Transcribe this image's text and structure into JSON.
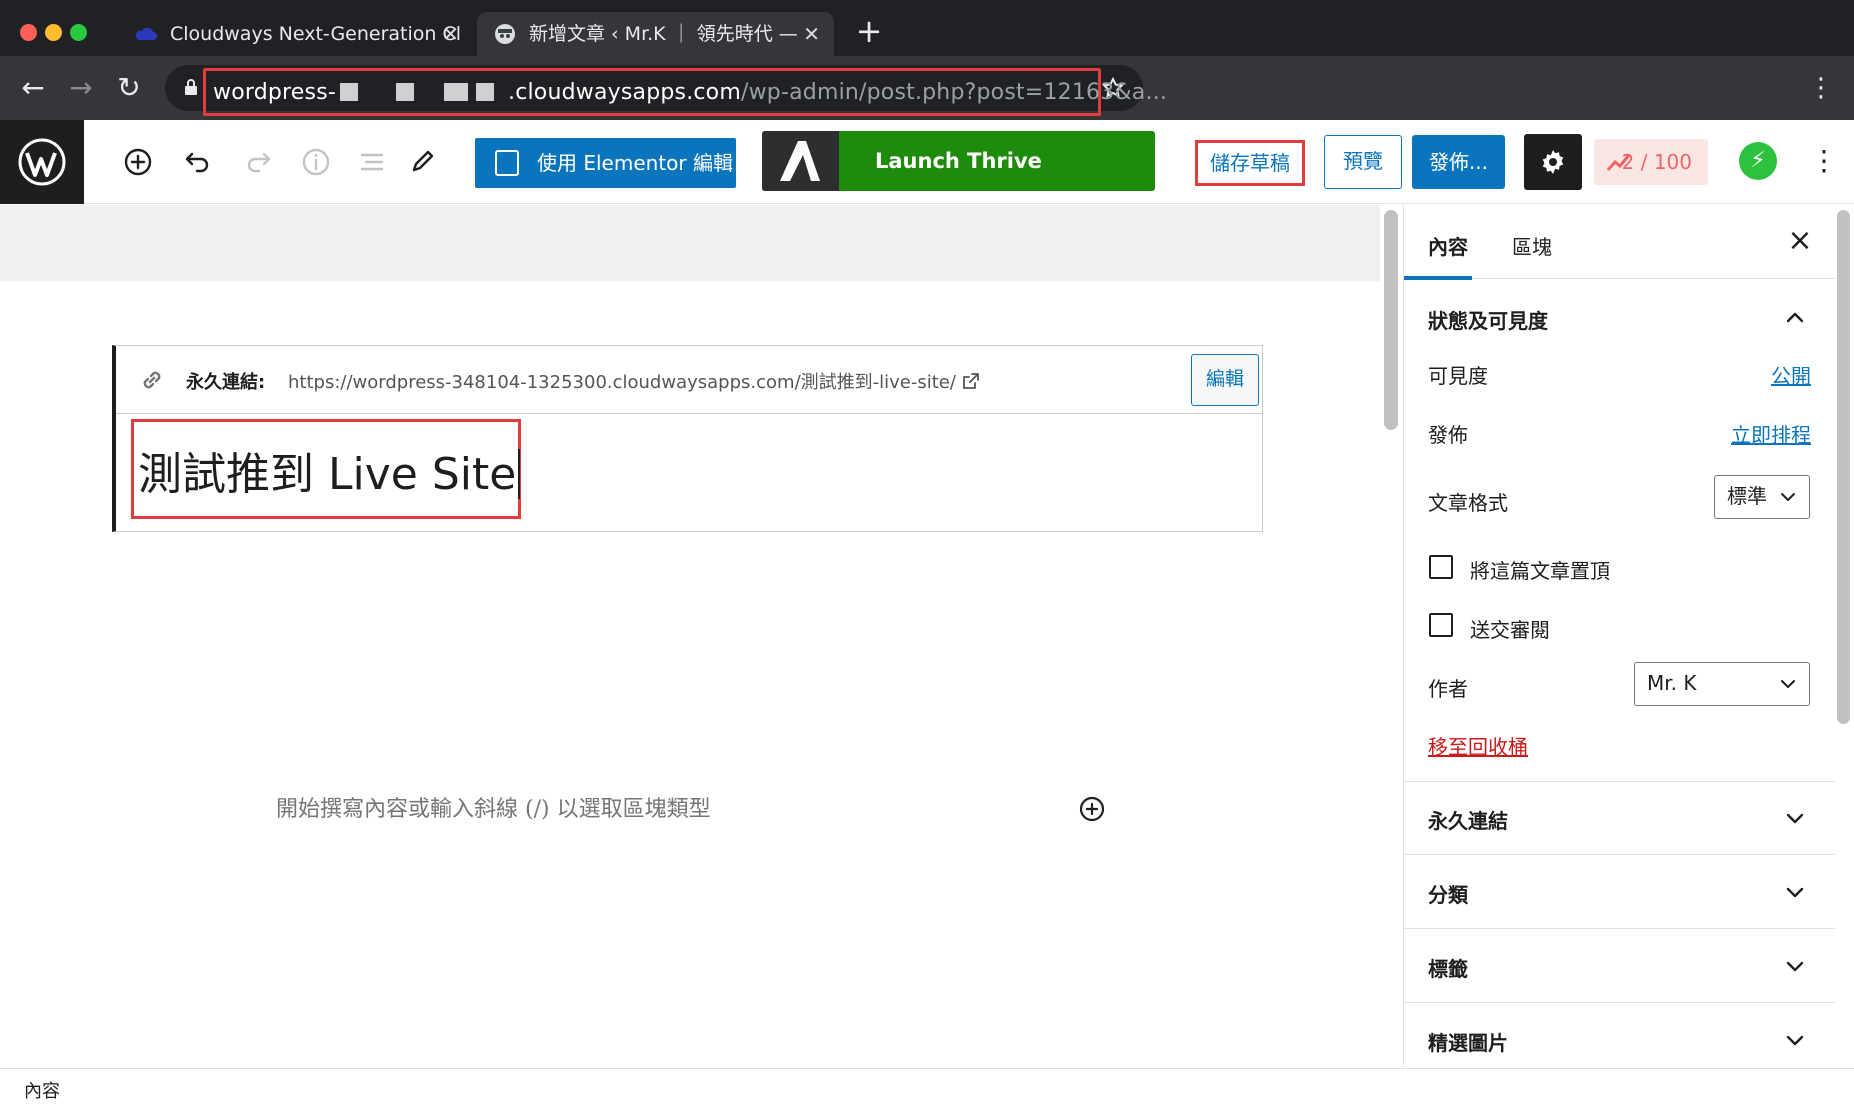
{
  "browser": {
    "tabs": [
      {
        "title": "Cloudways Next-Generation Cl",
        "active": false
      },
      {
        "title": "新增文章 ‹ Mr.K ｜ 領先時代 — ",
        "active": true
      }
    ],
    "address": {
      "host_start": "wordpress-",
      "host_end": ".cloudwaysapps.com",
      "path": "/wp-admin/post.php?post=12163&a..."
    },
    "extensions": [
      "stop-sign-icon",
      "translate-icon",
      "s-extension-icon",
      "v-extension-icon",
      "notion-icon",
      "pdf-icon",
      "github-icon",
      "wallet-icon",
      "m-extension-icon",
      "k-extension-icon",
      "d-extension-icon",
      "vivaldi-icon"
    ]
  },
  "toolbar": {
    "elementor_label": "使用 Elementor 編輯",
    "thrive_label": "Launch Thrive Architect",
    "save_draft_label": "儲存草稿",
    "preview_label": "預覽",
    "publish_label": "發佈...",
    "counter": "2 / 100"
  },
  "editor": {
    "permalink_label": "永久連結:",
    "permalink_url": "https://wordpress-348104-1325300.cloudwaysapps.com/測試推到-live-site/",
    "permalink_edit": "編輯",
    "title": "測試推到 Live Site",
    "placeholder": "開始撰寫內容或輸入斜線 (/) 以選取區塊類型"
  },
  "sidebar": {
    "tabs": [
      "內容",
      "區塊"
    ],
    "status_panel_title": "狀態及可見度",
    "visibility_label": "可見度",
    "visibility_value": "公開",
    "publish_label": "發佈",
    "publish_value": "立即排程",
    "format_label": "文章格式",
    "format_value": "標準",
    "sticky_label": "將這篇文章置頂",
    "review_label": "送交審閱",
    "author_label": "作者",
    "author_value": "Mr. K",
    "trash_label": "移至回收桶",
    "panels": [
      "永久連結",
      "分類",
      "標籤",
      "精選圖片"
    ]
  },
  "footer": {
    "breadcrumb": "內容"
  },
  "colors": {
    "accent": "#0a75bc",
    "highlight": "#e23c3c",
    "thrive_green": "#1f8b0c",
    "counter_red": "#e66666"
  }
}
